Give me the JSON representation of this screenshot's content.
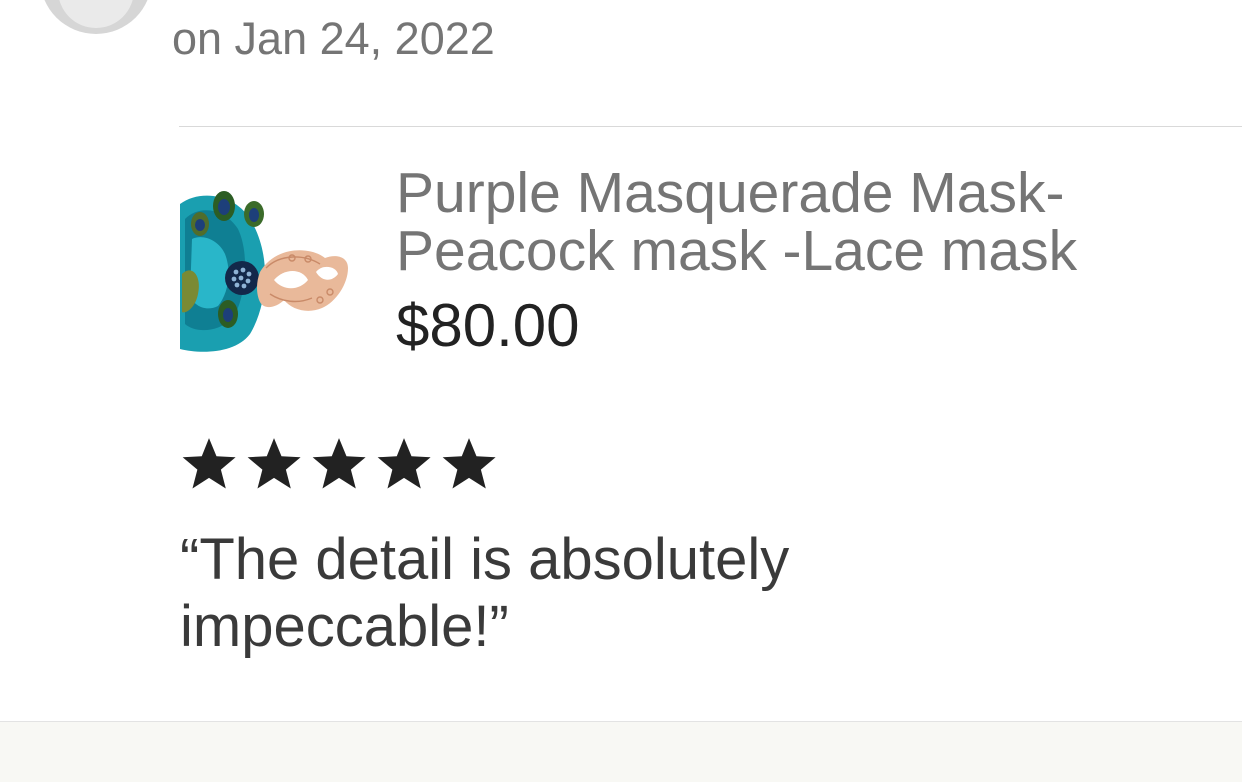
{
  "review": {
    "date": "on Jan 24, 2022",
    "rating": 5,
    "max_rating": 5,
    "text": "“The detail is absolutely impeccable!”"
  },
  "item": {
    "title": "Purple Masquerade Mask- Peacock mask -Lace mask",
    "price": "$80.00",
    "thumbnail_icon": "peacock-lace-mask-image"
  },
  "colors": {
    "star": "#222222",
    "title": "#757575",
    "price": "#222222",
    "date": "#757575",
    "review_text": "#3a3a3a",
    "footer_bg": "#f8f8f4"
  }
}
